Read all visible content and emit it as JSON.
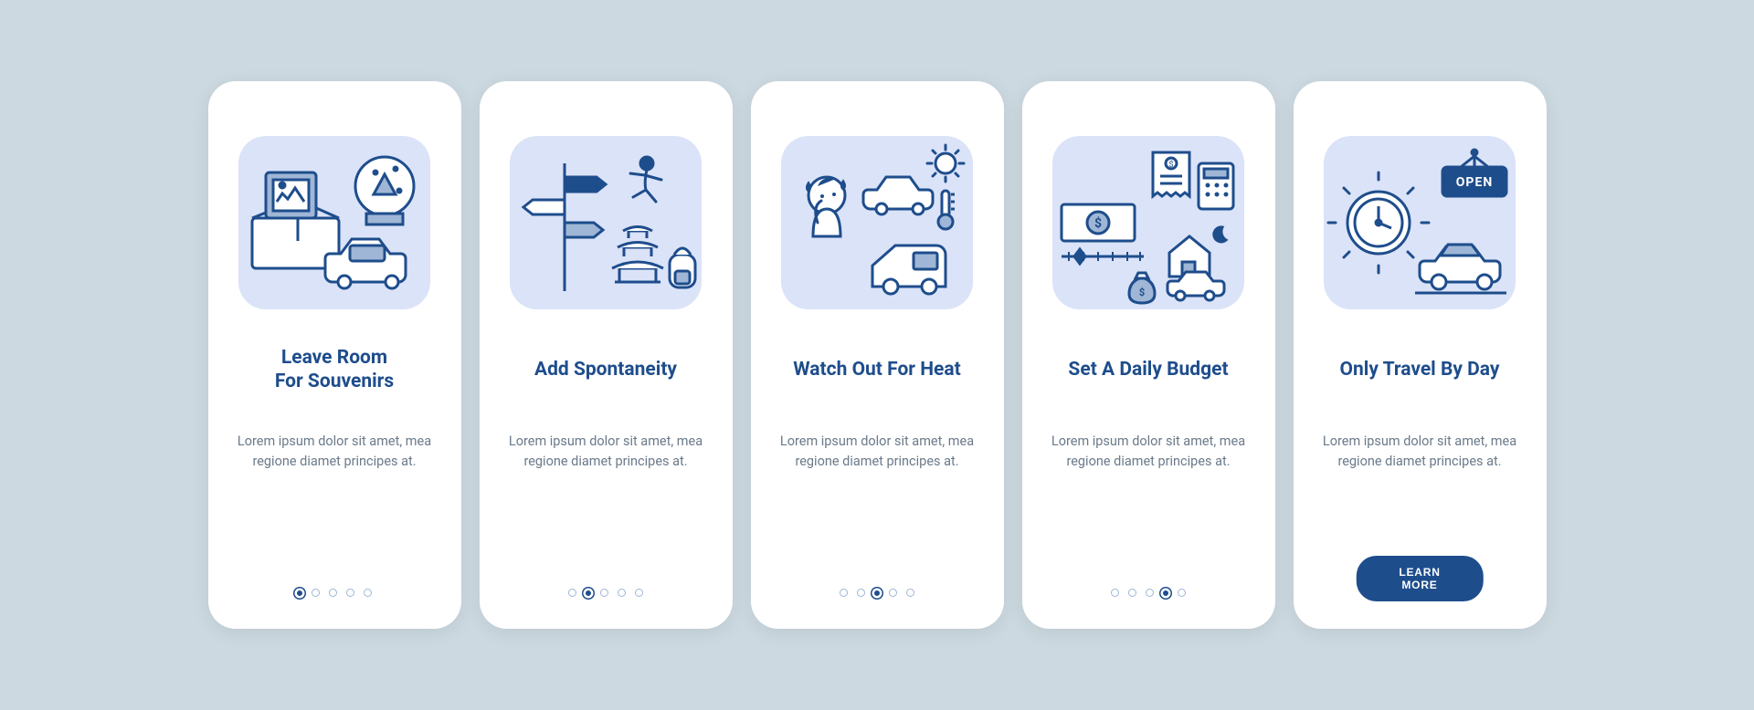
{
  "cards": [
    {
      "title": "Leave Room\nFor Souvenirs",
      "body": "Lorem ipsum dolor sit amet, mea regione diamet principes at."
    },
    {
      "title": "Add Spontaneity",
      "body": "Lorem ipsum dolor sit amet, mea regione diamet principes at."
    },
    {
      "title": "Watch Out For Heat",
      "body": "Lorem ipsum dolor sit amet, mea regione diamet principes at."
    },
    {
      "title": "Set A Daily Budget",
      "body": "Lorem ipsum dolor sit amet, mea regione diamet principes at."
    },
    {
      "title": "Only Travel By Day",
      "body": "Lorem ipsum dolor sit amet, mea regione diamet principes at."
    }
  ],
  "cta_label": "LEARN MORE",
  "colors": {
    "accent": "#1e4d8c",
    "illus_bg": "#dbe3f8",
    "page_bg": "#ccd9e0",
    "muted": "#6b7a8a"
  },
  "dot_count": 5
}
